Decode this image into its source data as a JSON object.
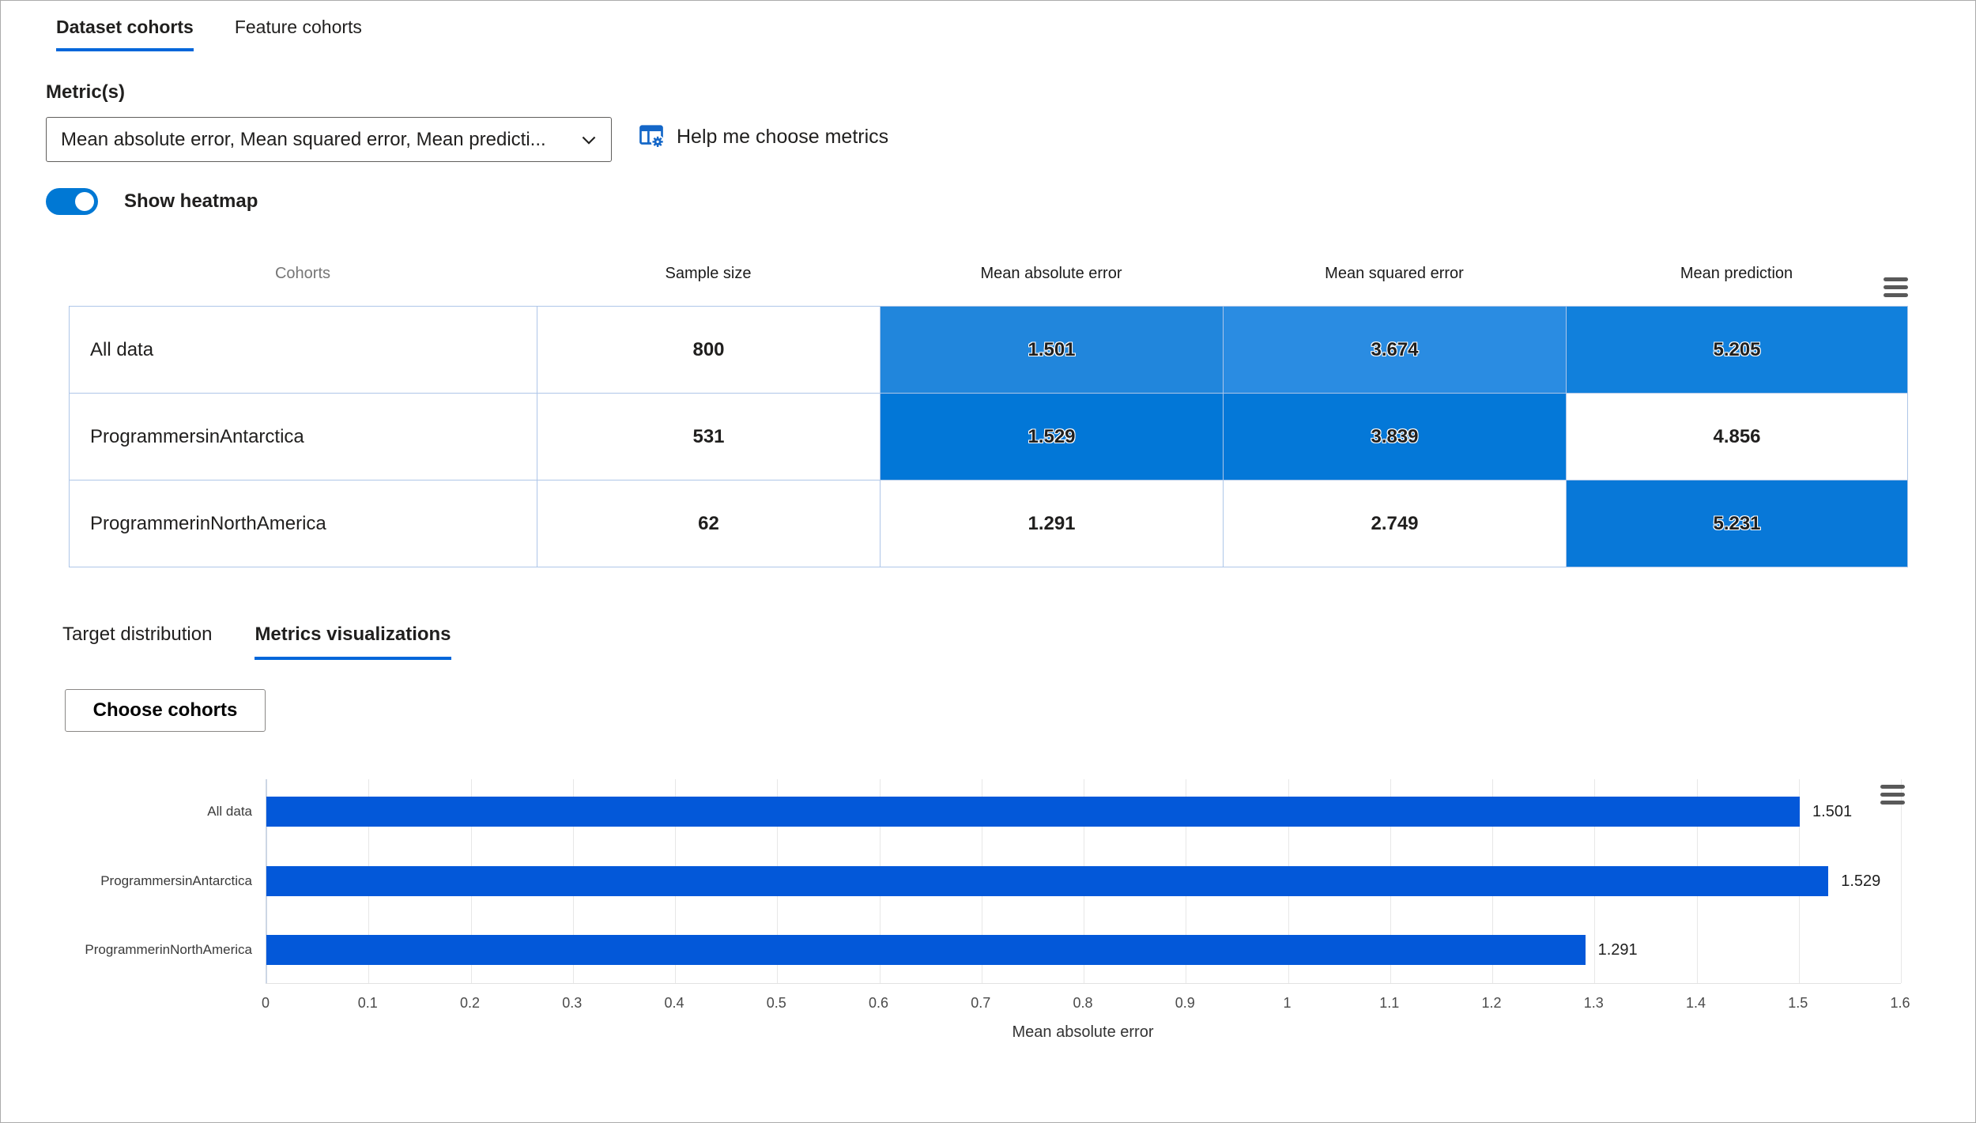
{
  "tabs": [
    {
      "label": "Dataset cohorts",
      "active": true
    },
    {
      "label": "Feature cohorts",
      "active": false
    }
  ],
  "metric_section": {
    "label": "Metric(s)",
    "dropdown_value": "Mean absolute error, Mean squared error, Mean predicti...",
    "help_label": "Help me choose metrics",
    "toggle_label": "Show heatmap",
    "toggle_on": true
  },
  "icons": {
    "dropdown_chevron": "chevron-down",
    "help": "table-settings",
    "table_menu": "hamburger",
    "chart_menu": "hamburger"
  },
  "colors": {
    "accent_underline": "#0066DA",
    "toggle_on": "#0078D4",
    "table_border": "#AEC6E8",
    "bar_blue": "#0358D9"
  },
  "table": {
    "columns": [
      "Cohorts",
      "Sample size",
      "Mean absolute error",
      "Mean squared error",
      "Mean prediction"
    ],
    "rows": [
      {
        "name": "All data",
        "sample_size": "800",
        "values": [
          "1.501",
          "3.674",
          "5.205"
        ],
        "heat_colors": [
          "#2186DC",
          "#2A8CE2",
          "#1180DC"
        ]
      },
      {
        "name": "ProgrammersinAntarctica",
        "sample_size": "531",
        "values": [
          "1.529",
          "3.839",
          "4.856"
        ],
        "heat_colors": [
          "#0277D7",
          "#0478D8",
          null
        ]
      },
      {
        "name": "ProgrammerinNorthAmerica",
        "sample_size": "62",
        "values": [
          "1.291",
          "2.749",
          "5.231"
        ],
        "heat_colors": [
          null,
          null,
          "#0878D8"
        ]
      }
    ]
  },
  "sub_tabs": [
    {
      "label": "Target distribution",
      "active": false
    },
    {
      "label": "Metrics visualizations",
      "active": true
    }
  ],
  "choose_cohorts_label": "Choose cohorts",
  "chart_data": {
    "type": "bar",
    "orientation": "horizontal",
    "categories": [
      "All data",
      "ProgrammersinAntarctica",
      "ProgrammerinNorthAmerica"
    ],
    "values": [
      1.501,
      1.529,
      1.291
    ],
    "value_labels": [
      "1.501",
      "1.529",
      "1.291"
    ],
    "xlabel": "Mean absolute error",
    "xlim": [
      0,
      1.6
    ],
    "xticks": [
      "0",
      "0.1",
      "0.2",
      "0.3",
      "0.4",
      "0.5",
      "0.6",
      "0.7",
      "0.8",
      "0.9",
      "1",
      "1.1",
      "1.2",
      "1.3",
      "1.4",
      "1.5",
      "1.6"
    ],
    "grid": true,
    "legend": "none",
    "bar_color": "#0358D9"
  }
}
